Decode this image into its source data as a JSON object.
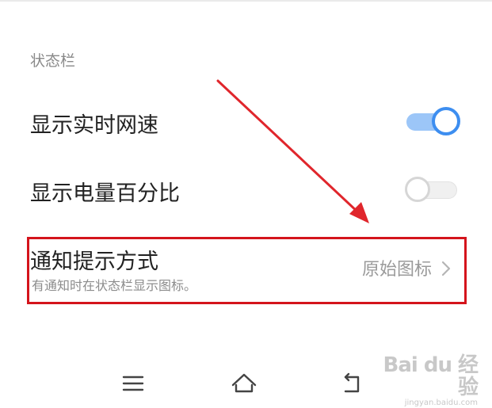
{
  "section": {
    "title": "状态栏"
  },
  "settings": [
    {
      "label": "显示实时网速",
      "enabled": true
    },
    {
      "label": "显示电量百分比",
      "enabled": false
    }
  ],
  "notification": {
    "title": "通知提示方式",
    "description": "有通知时在状态栏显示图标。",
    "value": "原始图标"
  },
  "colors": {
    "toggle_on": "#3d8ef0",
    "toggle_track_on": "#9cc6f8",
    "highlight_box": "#d4141c",
    "arrow": "#e0262c"
  },
  "navbar": {
    "items": [
      {
        "icon": "menu-icon"
      },
      {
        "icon": "home-icon"
      },
      {
        "icon": "back-icon"
      }
    ]
  },
  "watermark": {
    "text": "Bai du 经验",
    "sub": "jingyan.baidu.com"
  }
}
